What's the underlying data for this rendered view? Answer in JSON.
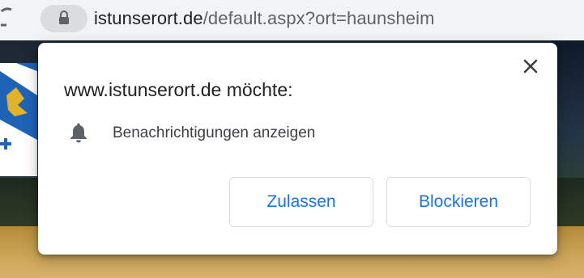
{
  "browser": {
    "url_host": "istunserort.de",
    "url_path": "/default.aspx?ort=haunsheim",
    "icons": {
      "reload": "reload-icon",
      "lock": "lock-icon"
    }
  },
  "dialog": {
    "title": "www.istunserort.de möchte:",
    "permission_label": "Benachrichtigungen anzeigen",
    "permission_icon": "bell-icon",
    "close_icon": "close-icon",
    "allow_label": "Zulassen",
    "block_label": "Blockieren"
  },
  "colors": {
    "accent": "#1a73e8",
    "chrome_bg": "#f1f3f4",
    "text_primary": "#202124"
  }
}
